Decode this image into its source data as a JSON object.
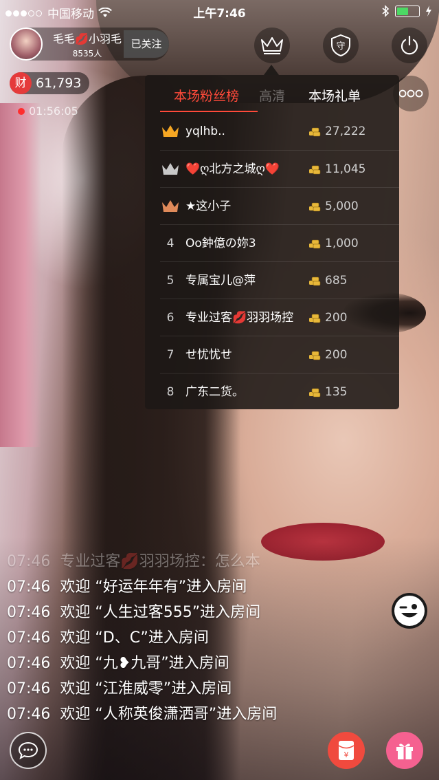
{
  "status_bar": {
    "carrier": "中国移动",
    "time": "上午7:46"
  },
  "host": {
    "name": "毛毛💋小羽毛",
    "fans": "8535人",
    "follow_label": "已关注"
  },
  "wealth": {
    "badge": "财",
    "value": "61,793"
  },
  "live_timer": "01:56:05",
  "icons": {
    "crown": "crown-icon",
    "guard": "守",
    "power": "power-icon",
    "more": "more-icon"
  },
  "leaderboard": {
    "tabs": {
      "fans": "本场粉丝榜",
      "hidden": "高清",
      "gifts": "本场礼单"
    },
    "rows": [
      {
        "rank": "",
        "medal": "gold",
        "name": "yqlhb..",
        "amount": "27,222"
      },
      {
        "rank": "",
        "medal": "silver",
        "name": "❤️ღ北方之城ღ❤️",
        "amount": "11,045"
      },
      {
        "rank": "",
        "medal": "bronze",
        "name": "★这小子",
        "amount": "5,000"
      },
      {
        "rank": "4",
        "medal": "",
        "name": "Oo鈡億の妳3",
        "amount": "1,000"
      },
      {
        "rank": "5",
        "medal": "",
        "name": "专属宝儿@萍",
        "amount": "685"
      },
      {
        "rank": "6",
        "medal": "",
        "name": "专业过客💋羽羽场控",
        "amount": "200"
      },
      {
        "rank": "7",
        "medal": "",
        "name": "せ忧忧せ",
        "amount": "200"
      },
      {
        "rank": "8",
        "medal": "",
        "name": "广东二货。",
        "amount": "135"
      }
    ]
  },
  "chat": [
    {
      "time": "07:46",
      "text": "专业过客💋羽羽场控：怎么本",
      "faded": true
    },
    {
      "time": "07:46",
      "text": "欢迎 “好运年年有”进入房间",
      "faded": false
    },
    {
      "time": "07:46",
      "text": "欢迎 “人生过客555”进入房间",
      "faded": false
    },
    {
      "time": "07:46",
      "text": "欢迎 “D、C”进入房间",
      "faded": false
    },
    {
      "time": "07:46",
      "text": "欢迎 “九❥九哥”进入房间",
      "faded": false
    },
    {
      "time": "07:46",
      "text": "欢迎 “江淮威零”进入房间",
      "faded": false
    },
    {
      "time": "07:46",
      "text": "欢迎 “人称英俊潇洒哥”进入房间",
      "faded": false
    }
  ],
  "bottom": {
    "red_packet_symbol": "¥"
  },
  "colors": {
    "accent": "#ff4a3a",
    "gold": "#f5a623",
    "silver": "#c8c8c8",
    "bronze": "#e08a5a",
    "coin": "#e8b83a"
  }
}
